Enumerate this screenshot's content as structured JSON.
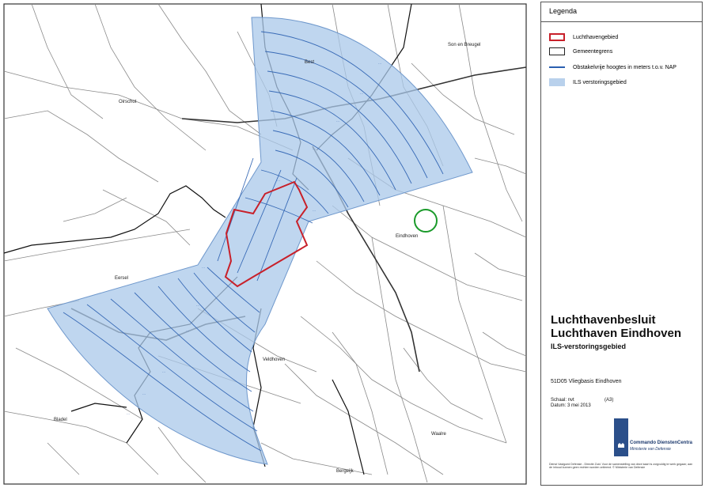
{
  "legend": {
    "title": "Legenda",
    "items": [
      {
        "label": "Luchthavengebied",
        "symbol": "airport-boundary"
      },
      {
        "label": "Gemeentegrens",
        "symbol": "municipal-boundary"
      },
      {
        "label": "Obstakelvrije hoogtes in meters t.o.v. NAP",
        "symbol": "obstacle-height-line"
      },
      {
        "label": "ILS verstoringsgebied",
        "symbol": "ils-area"
      }
    ]
  },
  "title_block": {
    "title_line1": "Luchthavenbesluit",
    "title_line2": "Luchthaven Eindhoven",
    "subtitle": "ILS-verstoringsgebied",
    "code": "51D05 Vliegbasis Eindhoven",
    "scale": "Schaal: nvt",
    "paper": "(A3)",
    "date": "Datum: 3 mei 2013",
    "logo_name": "Commando DienstenCentra",
    "logo_sub": "Ministerie van Defensie",
    "disclaimer": "Dienst Vastgoed Defensie - Directie Zuid. Voor de samenstelling van deze kaart is zorgvuldig te werk gegaan; aan de inhoud kunnen geen rechten worden ontleend. © Ministerie van Defensie"
  },
  "places": {
    "son_en_breugel": "Son en Breugel",
    "best": "Best",
    "oirschot": "Oirschot",
    "eindhoven": "Eindhoven",
    "eersel": "Eersel",
    "veldhoven": "Veldhoven",
    "bladel": "Bladel",
    "waalre": "Waalre",
    "bergeijk": "Bergeijk"
  },
  "colors": {
    "ils_fill": "#a9c8ea",
    "ils_stroke": "#6f98cc",
    "contour": "#2a5fb0",
    "airport": "#c8202a",
    "municipal": "#111111",
    "road": "#7a7a7a",
    "marker": "#1a9a2a"
  }
}
